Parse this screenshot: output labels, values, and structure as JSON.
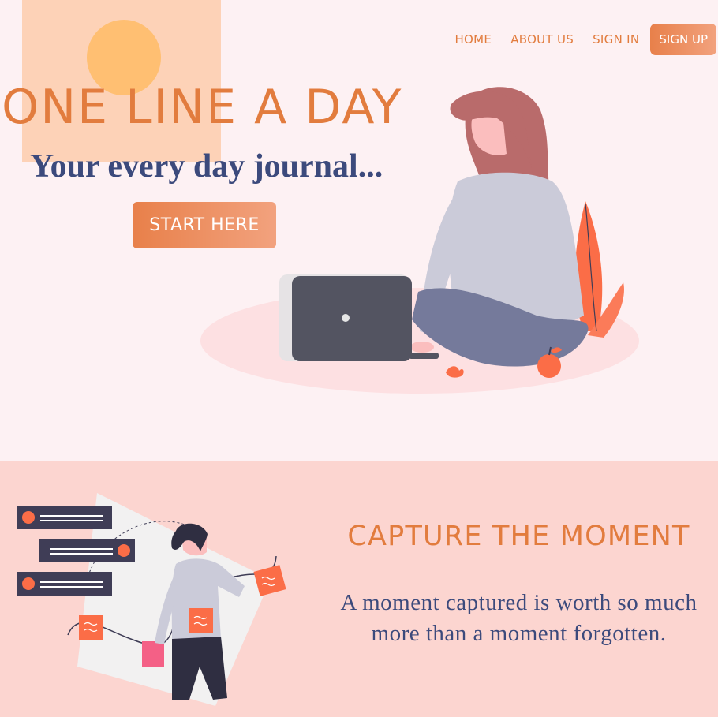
{
  "nav": {
    "home": "HOME",
    "about": "ABOUT US",
    "signin": "SIGN IN",
    "signup": "SIGN UP"
  },
  "hero": {
    "title": "ONE LINE A DAY",
    "tagline": "Your every day journal...",
    "cta": "START HERE",
    "illustration": "woman-with-laptop"
  },
  "moment": {
    "title": "CAPTURE THE MOMENT",
    "text": "A moment captured is worth so much more than a moment forgotten.",
    "illustration": "woman-with-notes"
  },
  "colors": {
    "accent": "#e27c3e",
    "navy": "#3c4a7c",
    "hero_bg": "#fdf1f3",
    "section_bg": "#fcd5d0",
    "sun": "#ffbf72",
    "sun_square": "#fdd2b7"
  }
}
